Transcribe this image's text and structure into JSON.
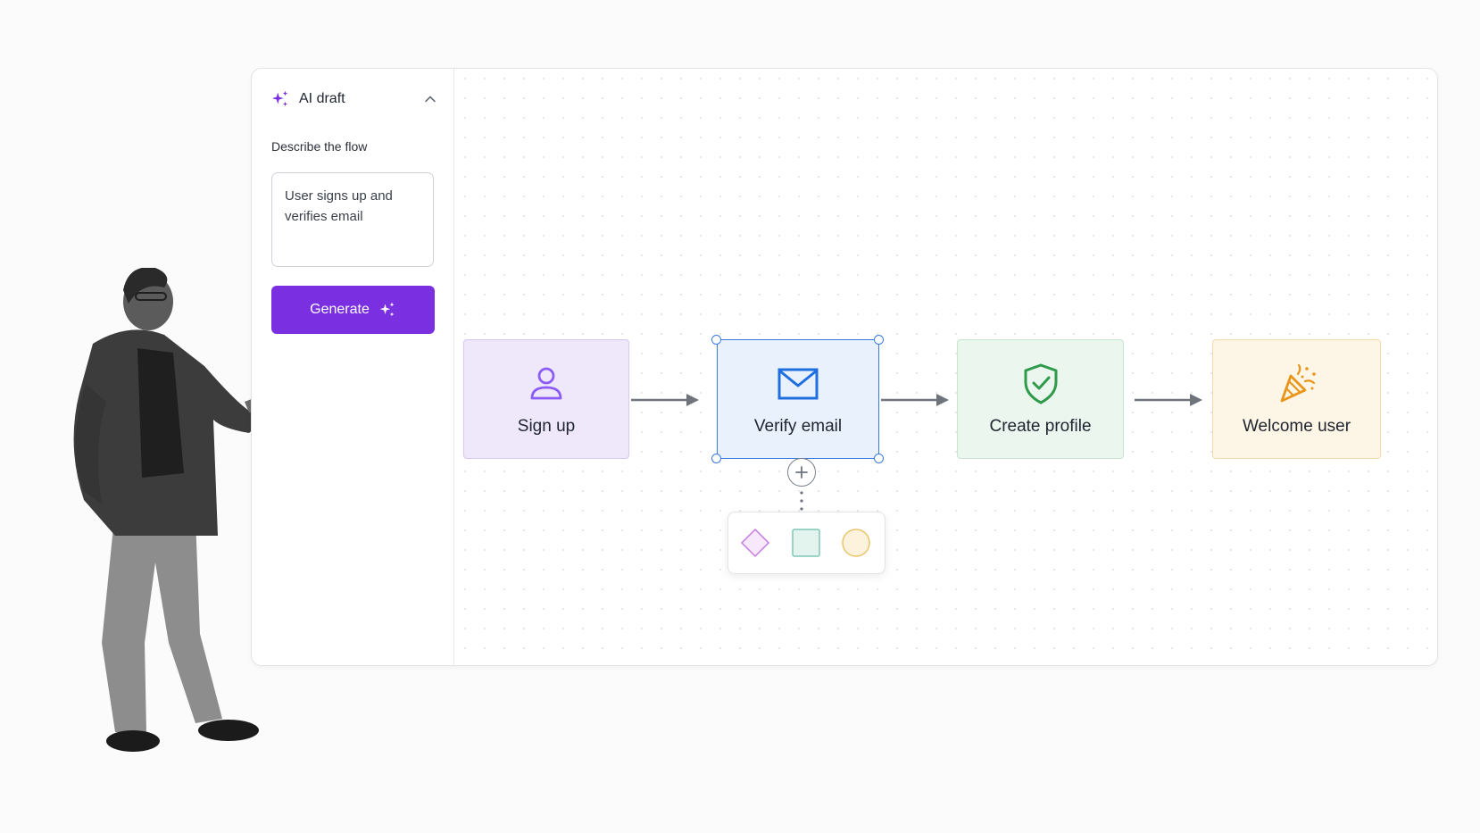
{
  "sidebar": {
    "title": "AI draft",
    "field_label": "Describe the flow",
    "prompt_value": "User signs up and verifies email",
    "generate_label": "Generate",
    "header_icon": "sparkle-icon",
    "collapse_icon": "chevron-up-icon"
  },
  "flow": {
    "nodes": [
      {
        "label": "Sign up",
        "icon": "user-icon",
        "color": "#8b5cf6"
      },
      {
        "label": "Verify email",
        "icon": "envelope-icon",
        "color": "#1f6fe0",
        "selected": true
      },
      {
        "label": "Create profile",
        "icon": "shield-check-icon",
        "color": "#2e9a4a"
      },
      {
        "label": "Welcome user",
        "icon": "party-popper-icon",
        "color": "#e8951a"
      }
    ],
    "shape_picker": [
      "diamond-shape",
      "square-shape",
      "circle-shape"
    ]
  },
  "colors": {
    "accent": "#7a2fe0",
    "selection": "#3a7be0"
  }
}
